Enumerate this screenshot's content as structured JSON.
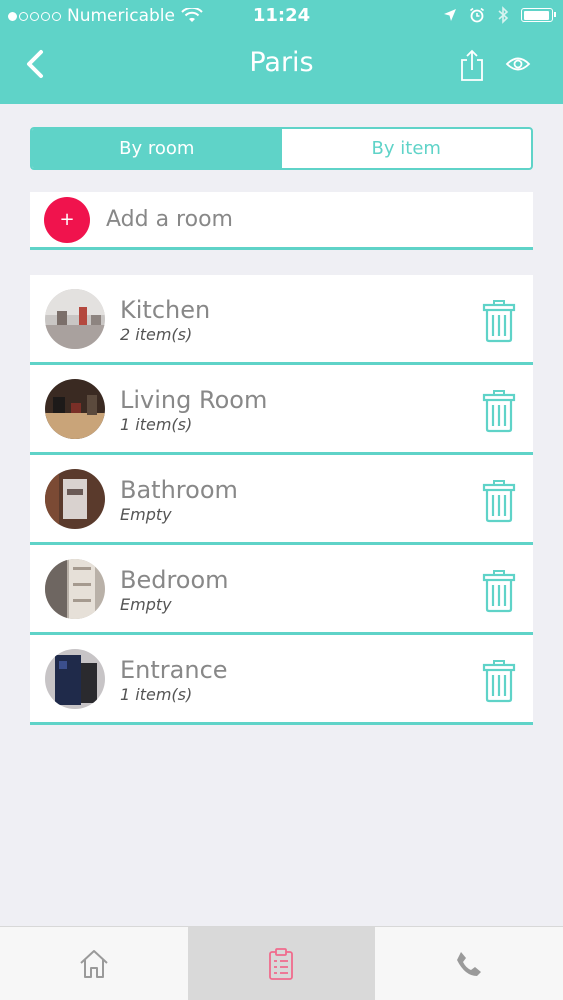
{
  "status": {
    "carrier": "Numericable",
    "time": "11:24",
    "signal_bars": 1,
    "battery_level": 0.95
  },
  "nav": {
    "title": "Paris"
  },
  "segmented": {
    "options": [
      "By room",
      "By item"
    ],
    "selected": "By room"
  },
  "add_room": {
    "label": "Add a room",
    "icon": "+"
  },
  "rooms": [
    {
      "name": "Kitchen",
      "count": "2 item(s)"
    },
    {
      "name": "Living Room",
      "count": "1 item(s)"
    },
    {
      "name": "Bathroom",
      "count": "Empty"
    },
    {
      "name": "Bedroom",
      "count": "Empty"
    },
    {
      "name": "Entrance",
      "count": "1 item(s)"
    }
  ],
  "tabbar": {
    "tabs": [
      "home-icon",
      "clipboard-list-icon",
      "phone-icon"
    ],
    "active_index": 1
  },
  "colors": {
    "accent": "#5fd3c8",
    "add_button": "#f0134d",
    "active_tab_icon": "#f06b8c",
    "inactive_tab_icon": "#9a9a9a"
  }
}
